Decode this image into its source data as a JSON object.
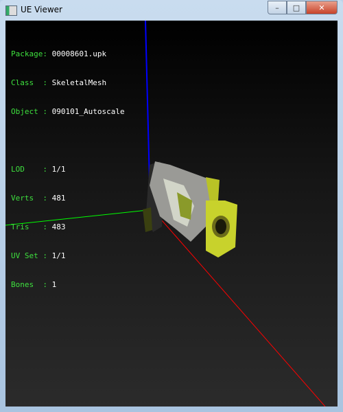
{
  "window": {
    "title": "UE Viewer",
    "minimize": "–",
    "maximize": "□",
    "close": "✕"
  },
  "info": {
    "rows1": [
      {
        "label": "Package:",
        "value": "00008601.upk"
      },
      {
        "label": "Class  :",
        "value": "SkeletalMesh"
      },
      {
        "label": "Object :",
        "value": "090101_Autoscale"
      }
    ],
    "rows2": [
      {
        "label": "LOD    :",
        "value": "1/1"
      },
      {
        "label": "Verts  :",
        "value": "481"
      },
      {
        "label": "Tris   :",
        "value": "483"
      },
      {
        "label": "UV Set :",
        "value": "1/1"
      },
      {
        "label": "Bones  :",
        "value": "1"
      }
    ]
  },
  "colors": {
    "x_axis": "#ff0000",
    "y_axis": "#00ff00",
    "z_axis": "#0000ff",
    "label": "#3ee03e"
  }
}
